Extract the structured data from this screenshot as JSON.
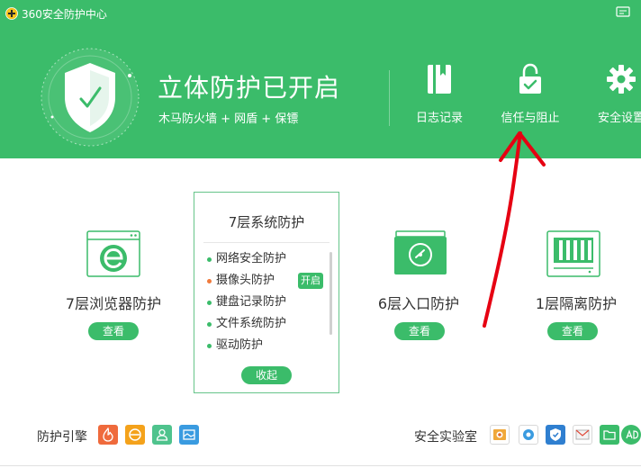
{
  "app": {
    "title": "360安全防护中心",
    "icons": {
      "logo": "360-logo-icon",
      "feedback": "feedback-icon"
    }
  },
  "status": {
    "title": "立体防护已开启",
    "subtitle": "木马防火墙 + 网盾 + 保镖",
    "icon": "shield-check-icon"
  },
  "header_buttons": [
    {
      "label": "日志记录",
      "icon": "log-book-icon"
    },
    {
      "label": "信任与阻止",
      "icon": "lock-check-icon"
    },
    {
      "label": "安全设置",
      "icon": "gear-icon"
    }
  ],
  "cards": {
    "browser": {
      "title": "7层浏览器防护",
      "button": "查看",
      "icon": "browser-e-icon"
    },
    "system": {
      "title": "7层系统防护",
      "items": [
        {
          "label": "网络安全防护",
          "state": "on"
        },
        {
          "label": "摄像头防护",
          "state": "off"
        },
        {
          "label": "键盘记录防护",
          "state": "on"
        },
        {
          "label": "文件系统防护",
          "state": "on"
        },
        {
          "label": "驱动防护",
          "state": "on"
        }
      ],
      "enable_button": "开启",
      "collapse_button": "收起"
    },
    "entry": {
      "title": "6层入口防护",
      "button": "查看",
      "icon": "entry-drive-icon"
    },
    "isolation": {
      "title": "1层隔离防护",
      "button": "查看",
      "icon": "isolation-cabinet-icon"
    }
  },
  "bottom": {
    "engine_label": "防护引擎",
    "engine_icons": [
      "engine-fire-icon",
      "engine-browser-icon",
      "engine-user-icon",
      "engine-image-icon"
    ],
    "engine_colors": [
      "#ef6a3c",
      "#f4a21b",
      "#4fc38d",
      "#3a9be0"
    ],
    "lab_label": "安全实验室",
    "lab_icons": [
      "lab-photo-icon",
      "lab-gear-icon",
      "lab-shield-icon",
      "lab-mail-icon",
      "lab-folder-icon",
      "lab-ad-icon"
    ]
  },
  "colors": {
    "brand_green": "#3bbc6a",
    "alert_orange": "#f07a3c",
    "annotation_red": "#e60012"
  }
}
